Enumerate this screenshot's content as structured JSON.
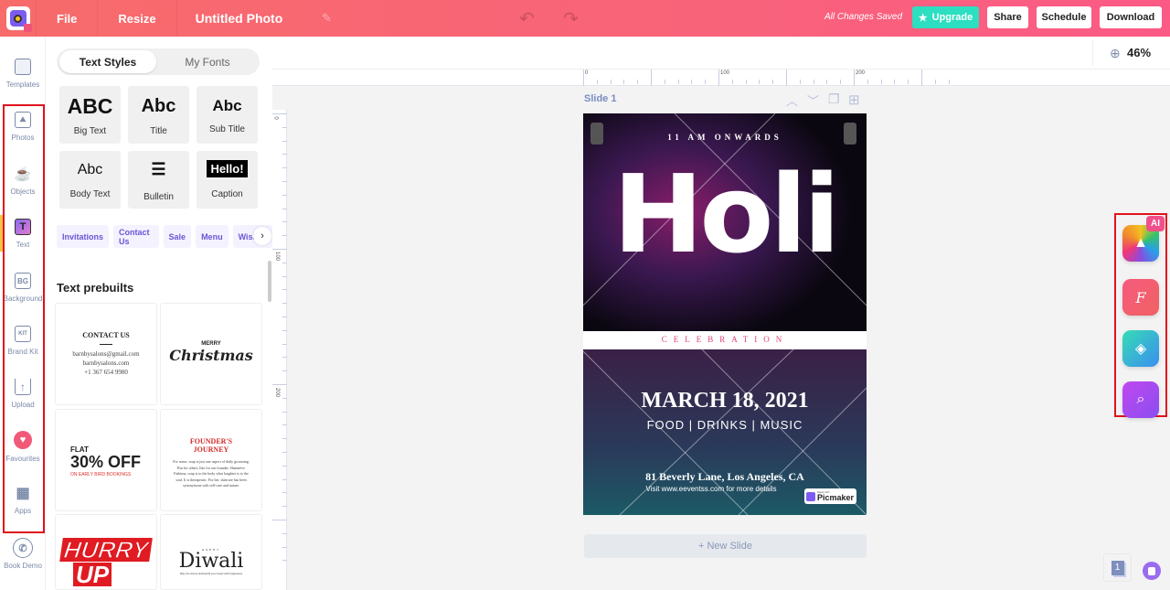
{
  "topbar": {
    "menu": [
      "File",
      "Resize"
    ],
    "title": "Untitled Photo",
    "status": "All Changes Saved",
    "buttons": {
      "upgrade": "Upgrade",
      "share": "Share",
      "schedule": "Schedule",
      "download": "Download"
    },
    "accent": "#2ddec0"
  },
  "sidebar": {
    "items": [
      {
        "label": "Templates",
        "icon": "templates-icon"
      },
      {
        "label": "Photos",
        "icon": "photos-icon"
      },
      {
        "label": "Objects",
        "icon": "objects-icon"
      },
      {
        "label": "Text",
        "icon": "text-icon"
      },
      {
        "label": "Background",
        "icon": "background-icon"
      },
      {
        "label": "Brand Kit",
        "icon": "brand-kit-icon"
      },
      {
        "label": "Upload",
        "icon": "upload-icon"
      },
      {
        "label": "Favourites",
        "icon": "heart-icon"
      },
      {
        "label": "Apps",
        "icon": "apps-icon"
      },
      {
        "label": "Book Demo",
        "icon": "phone-icon"
      }
    ],
    "active": "Text"
  },
  "panel": {
    "tabs": [
      "Text Styles",
      "My Fonts"
    ],
    "styles": [
      {
        "glyph": "ABC",
        "label": "Big Text"
      },
      {
        "glyph": "Abc",
        "label": "Title"
      },
      {
        "glyph": "Abc",
        "label": "Sub Title"
      },
      {
        "glyph": "Abc",
        "label": "Body Text"
      },
      {
        "glyph": "☰",
        "label": "Bulletin"
      },
      {
        "glyph": "Hello!",
        "label": "Caption"
      }
    ],
    "chips": [
      "Invitations",
      "Contact Us",
      "Sale",
      "Menu",
      "Wishes"
    ],
    "prebuilts_title": "Text prebuilts",
    "prebuilts": {
      "contact": {
        "title": "CONTACT US",
        "email": "barnbysalons@gmail.com",
        "site": "barnbysalons.com",
        "phone": "+1 367 654 9980"
      },
      "christmas": {
        "top": "MERRY",
        "main": "Christmas"
      },
      "sale": {
        "top": "FLAT",
        "main": "30% OFF",
        "sub": "ON EARLY BIRD BOOKINGS"
      },
      "founder": {
        "title": "FOUNDER'S JOURNEY",
        "body": "For some, soap is just one aspect of daily grooming. But for others, like for our founder, Shameeve Fathima, soap is to the body what laughter is to the soul. It is therapeutic. For her, skincare has been synonymous with self-care and nature."
      },
      "hurry": {
        "line1": "HURRY",
        "line2": "UP"
      },
      "diwali": {
        "top": "HAPPY",
        "main": "Diwali",
        "sub": "May the divine festival fill your heart with happiness"
      }
    }
  },
  "canvas": {
    "zoom": "46%",
    "ruler_h": [
      "0",
      "100",
      "200"
    ],
    "ruler_v": [
      "0",
      "100",
      "200"
    ],
    "slide_label": "Slide 1",
    "new_slide": "+ New Slide",
    "page_count": "1",
    "design": {
      "time": "11 AM ONWARDS",
      "headline": "Holi",
      "band": "CELEBRATION",
      "date": "MARCH 18, 2021",
      "tagline": "FOOD | DRINKS | MUSIC",
      "address": "81 Beverly Lane, Los Angeles, CA",
      "visit": "Visit www.eeventss.com for more details",
      "watermark_small": "Made with",
      "watermark": "Picmaker"
    }
  },
  "ai_tools": {
    "badge": "AI",
    "items": [
      "ai-image-generator",
      "font-tool",
      "fill-tool",
      "image-search-tool"
    ]
  }
}
